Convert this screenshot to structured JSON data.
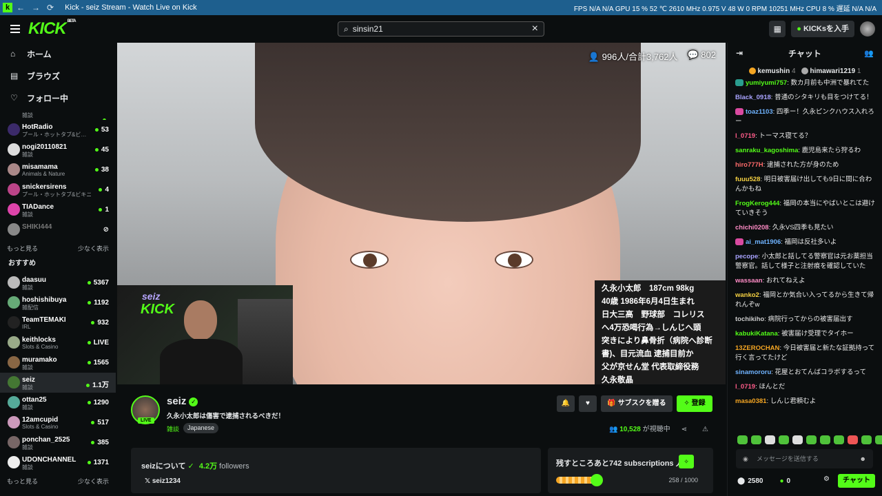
{
  "window": {
    "title": "Kick - seiz Stream - Watch Live on Kick",
    "perf": "FPS  N/A  N/A    GPU  15 %  52 ℃  2610 MHz  0.975 V  48 W  0 RPM  10251 MHz    CPU  8 %    遅延  N/A  N/A"
  },
  "header": {
    "logo": "KICK",
    "beta": "BETA",
    "search_value": "sinsin21",
    "kicks_label": "KICKsを入手"
  },
  "nav": [
    {
      "icon": "⌂",
      "label": "ホーム"
    },
    {
      "icon": "▤",
      "label": "ブラウズ"
    },
    {
      "icon": "♡",
      "label": "フォロー中"
    }
  ],
  "following": [
    {
      "name": "",
      "cat": "雑談",
      "viewers": ""
    },
    {
      "name": "HotRadio",
      "cat": "プール・ホットタブ&ビ…",
      "viewers": "53"
    },
    {
      "name": "nogi20110821",
      "cat": "雑談",
      "viewers": "45"
    },
    {
      "name": "misamama",
      "cat": "Animals & Nature",
      "viewers": "38"
    },
    {
      "name": "snickersirens",
      "cat": "プール・ホットタブ&ビキニ",
      "viewers": "4"
    },
    {
      "name": "TIADance",
      "cat": "雑談",
      "viewers": "1"
    },
    {
      "name": "SHIKI444",
      "cat": "",
      "viewers": "⊘"
    }
  ],
  "show_more": "もっと見る",
  "show_less": "少なく表示",
  "recommended_title": "おすすめ",
  "recommended": [
    {
      "name": "daasuu",
      "cat": "雑談",
      "viewers": "5367"
    },
    {
      "name": "hoshishibuya",
      "cat": "雑配信",
      "viewers": "1192"
    },
    {
      "name": "TeamTEMAKI",
      "cat": "IRL",
      "viewers": "932"
    },
    {
      "name": "keithlocks",
      "cat": "Slots & Casino",
      "viewers": "LIVE"
    },
    {
      "name": "muramako",
      "cat": "雑談",
      "viewers": "1565"
    },
    {
      "name": "seiz",
      "cat": "雑談",
      "viewers": "1.1万"
    },
    {
      "name": "ottan25",
      "cat": "雑談",
      "viewers": "1290"
    },
    {
      "name": "12amcupid",
      "cat": "Slots & Casino",
      "viewers": "517"
    },
    {
      "name": "ponchan_2525",
      "cat": "雑談",
      "viewers": "385"
    },
    {
      "name": "UDONCHANNEL",
      "cat": "雑談",
      "viewers": "1371"
    }
  ],
  "player": {
    "viewers": "996人/合計3,762人",
    "chat_count": "802",
    "cam_logo1": "seiz",
    "cam_logo2": "KICK",
    "overlay_lines": [
      "久永小太郎　187cm 98kg",
      "40歳 1986年6月4日生まれ",
      "日大三高　野球部　コレリス",
      "へ4万恐喝行為→しんじへ頭",
      "突きにより鼻骨折（病院へ診断",
      "書)、目元流血 逮捕目前か",
      "父が京せん堂 代表取締役務",
      "久永敬晶"
    ]
  },
  "channel": {
    "name": "seiz",
    "title": "久永小太郎は傷害で逮捕されるべきだ！",
    "category": "雑談",
    "tag": "Japanese",
    "live": "LIVE",
    "subscribe": "サブスクを贈る",
    "follow": "登録",
    "viewer_count": "10,528",
    "viewer_suffix": "が視聴中",
    "about": "seizについて",
    "followers_num": "4.2万",
    "followers_label": "followers",
    "twitter": "seiz1234",
    "sub_goal": "残すところあと742 subscriptions 人！",
    "sub_progress": "258 / 1000",
    "sub_fraction": 0.258
  },
  "chat": {
    "title": "チャット",
    "pinned": [
      {
        "name": "kemushin",
        "n": "4"
      },
      {
        "name": "himawari1219",
        "n": "1"
      }
    ],
    "messages": [
      {
        "user": "yumiyumi757",
        "color": "#53fc18",
        "badge": "#2a9d8f",
        "text": "数カ月前も中洲で暴れてた"
      },
      {
        "user": "Black_0918",
        "color": "#a9a3ff",
        "text": "普通のシタキリも目をつけてる！"
      },
      {
        "user": "toaz1103",
        "color": "#6fb3ff",
        "badge": "#d94aa0",
        "text": "四季ー！久永ピンクハウス入れろー"
      },
      {
        "user": "l_0719",
        "color": "#ff5c8a",
        "text": "トーマス寝てる？"
      },
      {
        "user": "sanraku_kagoshima",
        "color": "#53fc18",
        "text": "鹿児島来たら狩るわ"
      },
      {
        "user": "hiro777H",
        "color": "#ff6b6b",
        "text": "逮捕された方が身のため"
      },
      {
        "user": "fuuu528",
        "color": "#f5d142",
        "text": "明日被害届け出しても9日に間に合わんかもね"
      },
      {
        "user": "FrogKerog444",
        "color": "#53fc18",
        "text": "福岡の本当にやばいとこは避けていきそう"
      },
      {
        "user": "chichi0208",
        "color": "#ff8cc6",
        "text": "久永VS四季も見たい"
      },
      {
        "user": "ai_mat1906",
        "color": "#6fb3ff",
        "badge": "#d94aa0",
        "text": "福岡は反社多いよ"
      },
      {
        "user": "pecope",
        "color": "#a9a3ff",
        "text": "小太郎と話してる警察官は元お薬担当警察官。話して様子と注射痕を確認していた"
      },
      {
        "user": "wassaan",
        "color": "#ff8cc6",
        "text": "おれてねえよ"
      },
      {
        "user": "wanko2",
        "color": "#f5d142",
        "text": "福岡とか気合い入ってるから生きて帰れんぞw"
      },
      {
        "user": "tochikiho",
        "color": "#cccccc",
        "text": "病院行ってからの被害届出す"
      },
      {
        "user": "kabukiKatana",
        "color": "#53fc18",
        "text": "被害届け受理でタイホー"
      },
      {
        "user": "13ZEROCHAN",
        "color": "#f5a623",
        "text": "今日被害届と新たな証拠持って行く言ってたけど"
      },
      {
        "user": "sinamororu",
        "color": "#6fb3ff",
        "text": "花屋とおてんばコラボするって"
      },
      {
        "user": "l_0719",
        "color": "#ff5c8a",
        "text": "ほんとだ"
      },
      {
        "user": "masa0381",
        "color": "#f5a623",
        "text": "しんじ君頼むよ"
      }
    ],
    "input_placeholder": "メッセージを送信する",
    "points": "2580",
    "kicks": "0",
    "send": "チャット"
  }
}
